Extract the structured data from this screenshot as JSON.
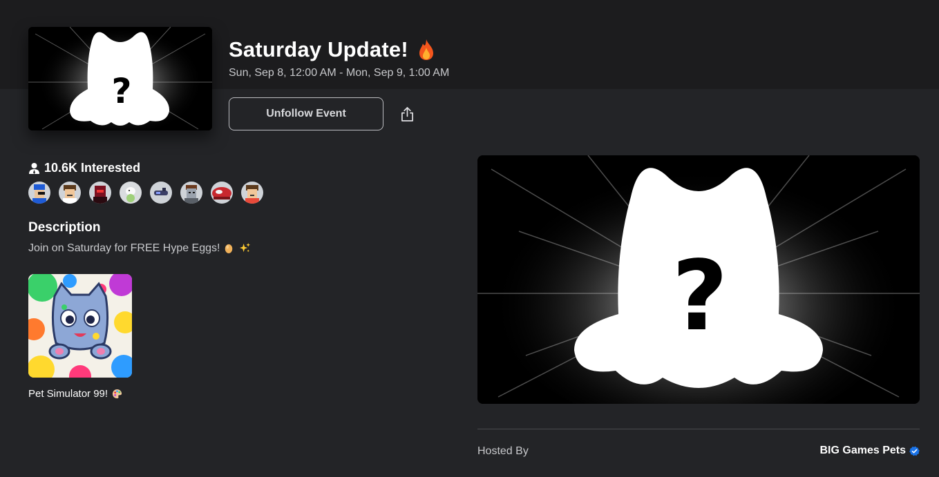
{
  "event": {
    "title": "Saturday Update!",
    "title_emoji": "fire-emoji",
    "dates": "Sun, Sep 8, 12:00 AM - Mon, Sep 9, 1:00 AM",
    "unfollow_label": "Unfollow Event",
    "share_icon": "share-icon"
  },
  "interested": {
    "count_label": "10.6K Interested",
    "icon": "person-icon",
    "avatar_count": 8
  },
  "description": {
    "heading": "Description",
    "text": "Join on Saturday for FREE Hype Eggs!",
    "emojis": [
      "egg-emoji",
      "sparkles-emoji"
    ]
  },
  "game": {
    "name": "Pet Simulator 99!",
    "emoji": "palette-emoji"
  },
  "host": {
    "label": "Hosted By",
    "name": "BIG Games Pets",
    "verified_icon": "verified-badge-icon"
  },
  "colors": {
    "background": "#232427",
    "top_band": "#1c1c1e",
    "muted_text": "#c8c9cc",
    "verified_blue": "#1a73e8",
    "button_border": "#bdbec2"
  }
}
